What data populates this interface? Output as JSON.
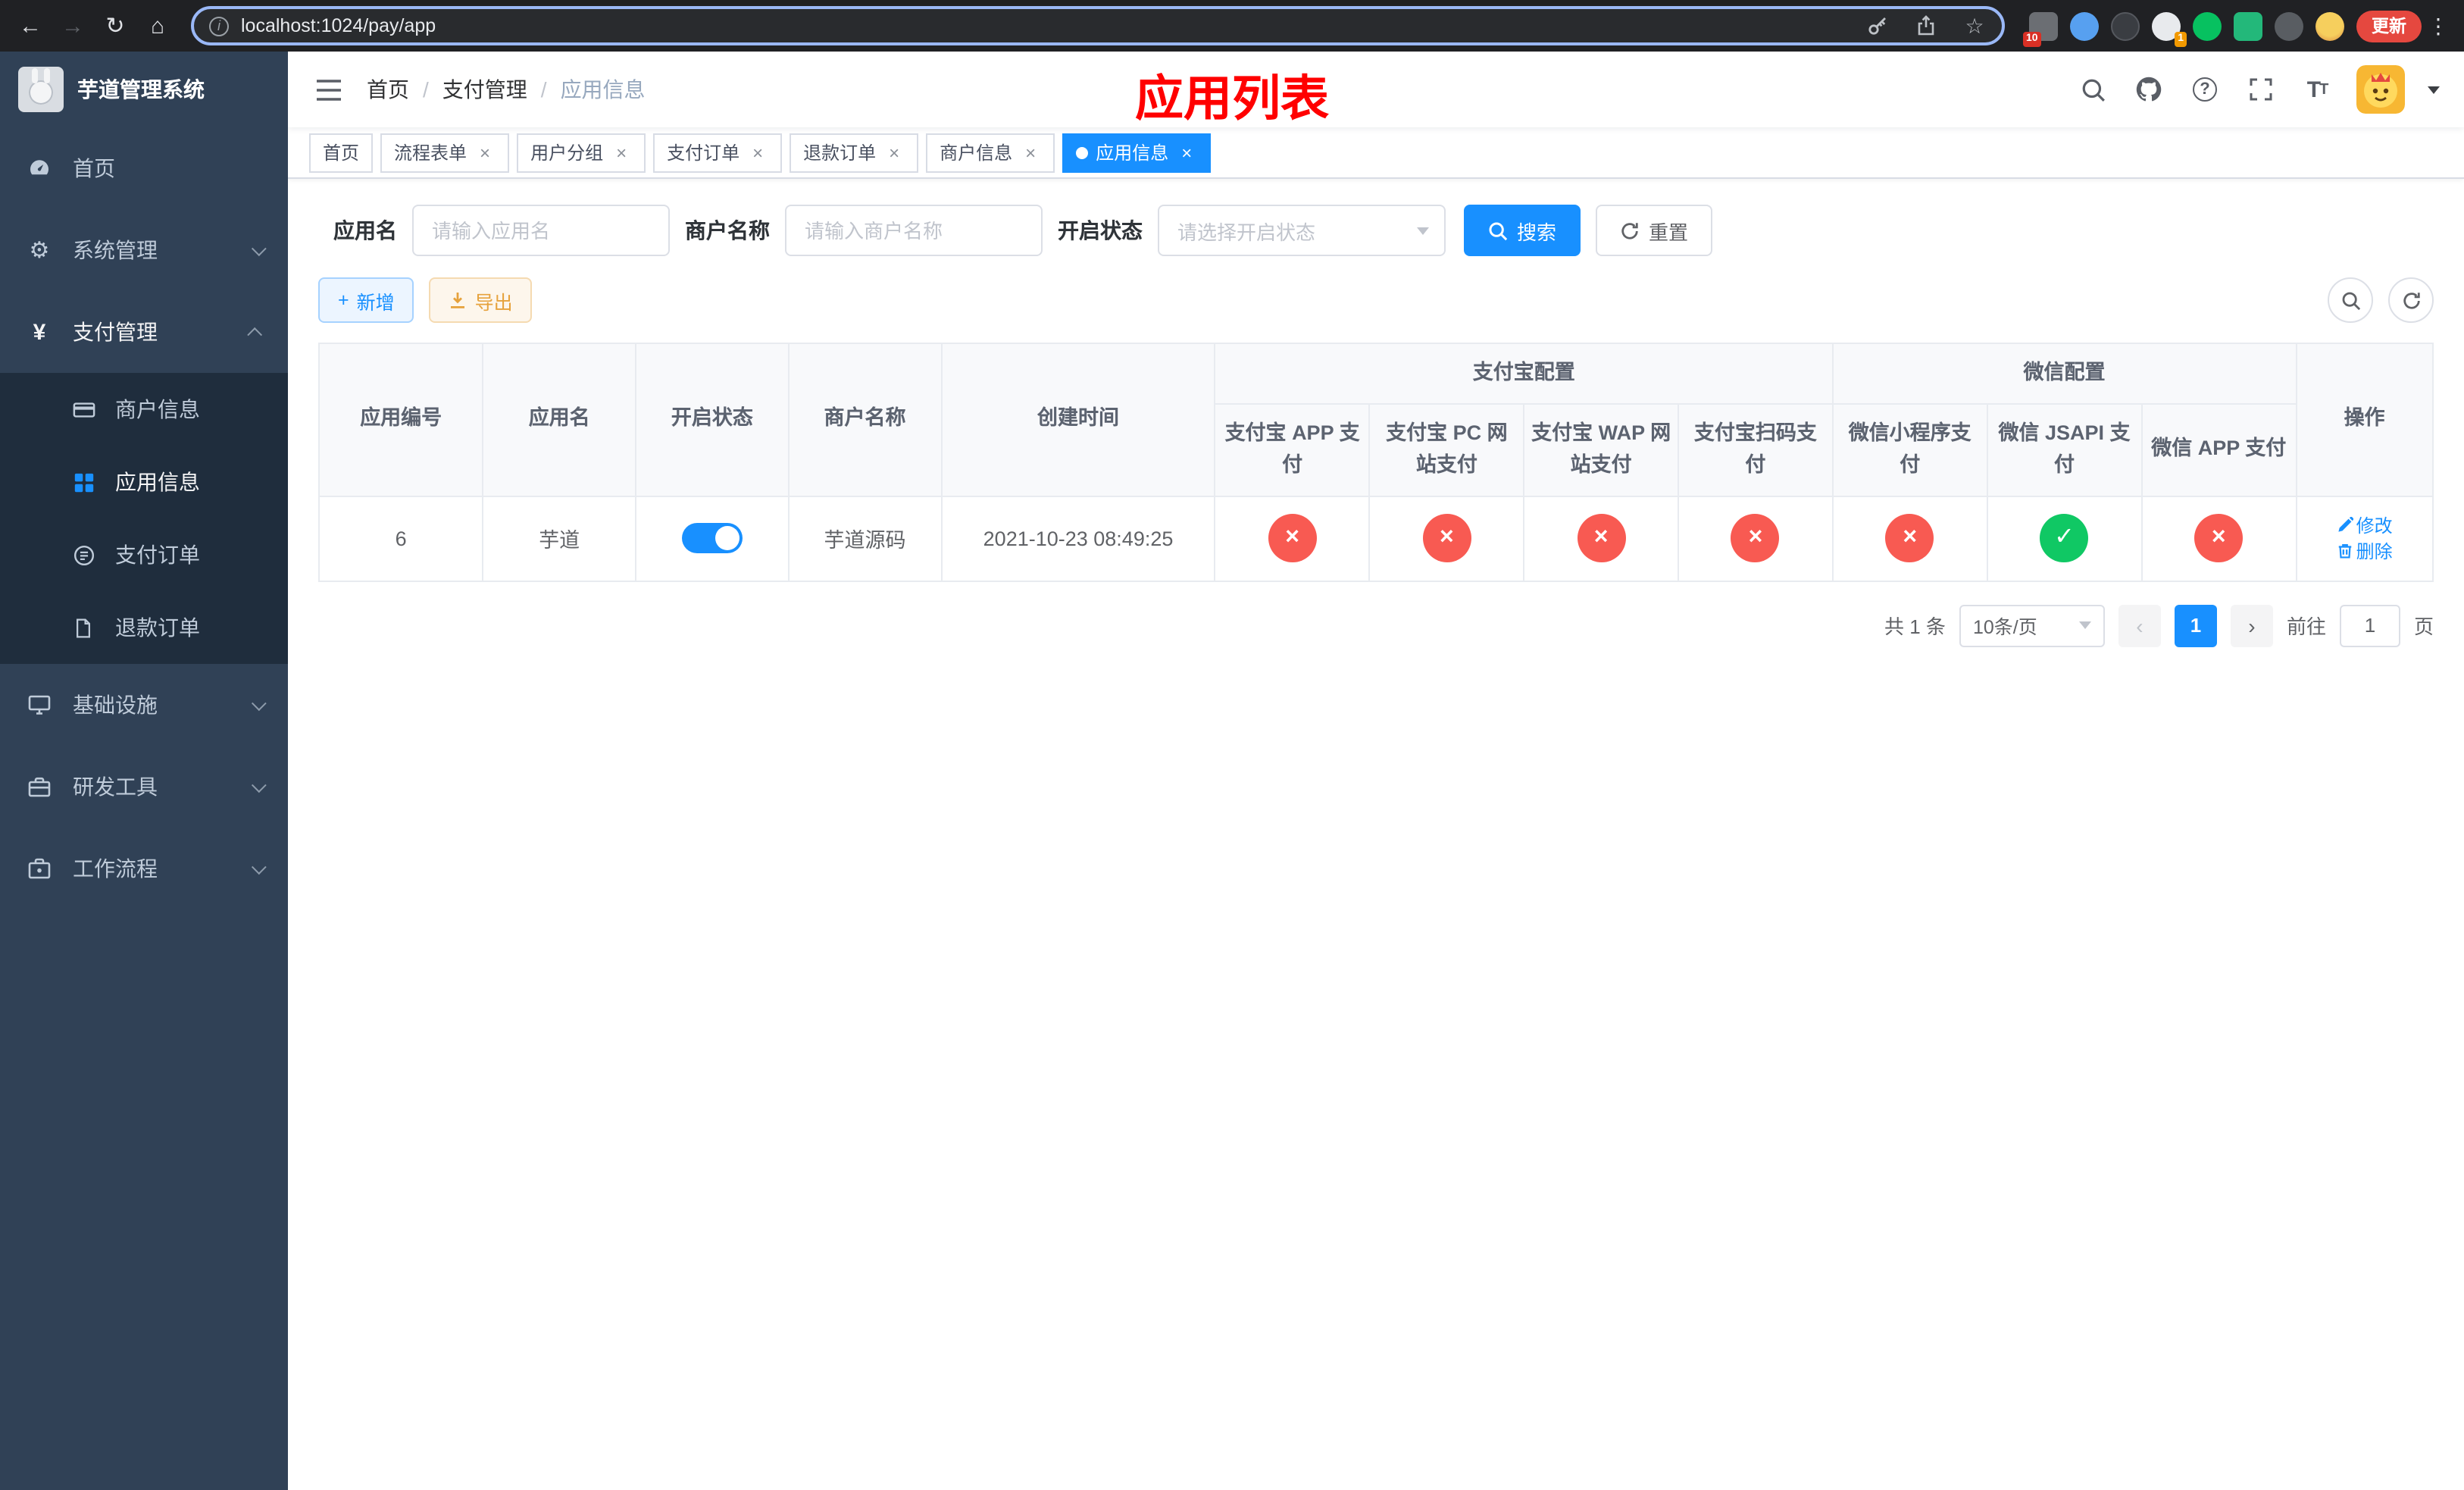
{
  "browser": {
    "url": "localhost:1024/pay/app",
    "update_button": "更新",
    "extension_badge_a": "10",
    "extension_badge_b": "1"
  },
  "icons": {
    "back": "←",
    "forward": "→",
    "reload": "↻",
    "home": "⌂",
    "info": "i",
    "star": "☆",
    "menu_dots": "⋮",
    "gear": "⚙",
    "yen": "¥",
    "plus": "+",
    "close": "×",
    "check": "✓",
    "cross": "×",
    "question": "?",
    "refresh": "↻"
  },
  "sidebar": {
    "app_title": "芋道管理系统",
    "items": {
      "home": "首页",
      "system": "系统管理",
      "payment": "支付管理",
      "merchant_info": "商户信息",
      "app_info": "应用信息",
      "pay_order": "支付订单",
      "refund_order": "退款订单",
      "infra": "基础设施",
      "dev_tools": "研发工具",
      "workflow": "工作流程"
    }
  },
  "header": {
    "breadcrumb": [
      "首页",
      "支付管理",
      "应用信息"
    ],
    "breadcrumb_sep": "/",
    "overlay_title": "应用列表",
    "font_icon_label": "T"
  },
  "tabs": [
    {
      "label": "首页"
    },
    {
      "label": "流程表单"
    },
    {
      "label": "用户分组"
    },
    {
      "label": "支付订单"
    },
    {
      "label": "退款订单"
    },
    {
      "label": "商户信息"
    },
    {
      "label": "应用信息"
    }
  ],
  "filters": {
    "app_name_label": "应用名",
    "app_name_placeholder": "请输入应用名",
    "merchant_name_label": "商户名称",
    "merchant_name_placeholder": "请输入商户名称",
    "status_label": "开启状态",
    "status_placeholder": "请选择开启状态",
    "search_button": "搜索",
    "reset_button": "重置"
  },
  "toolbar": {
    "add_button": "新增",
    "export_button": "导出"
  },
  "table": {
    "columns": {
      "app_id": "应用编号",
      "app_name": "应用名",
      "status": "开启状态",
      "merchant_name": "商户名称",
      "created_at": "创建时间",
      "alipay_group": "支付宝配置",
      "wechat_group": "微信配置",
      "alipay_app": "支付宝 APP 支付",
      "alipay_pc": "支付宝 PC 网站支付",
      "alipay_wap": "支付宝 WAP 网站支付",
      "alipay_qr": "支付宝扫码支付",
      "wechat_lite": "微信小程序支付",
      "wechat_jsapi": "微信 JSAPI 支付",
      "wechat_app": "微信 APP 支付",
      "actions": "操作"
    },
    "rows": [
      {
        "app_id": "6",
        "app_name": "芋道",
        "enabled": true,
        "merchant_name": "芋道源码",
        "created_at": "2021-10-23 08:49:25",
        "channels": {
          "alipay_app": false,
          "alipay_pc": false,
          "alipay_wap": false,
          "alipay_qr": false,
          "wechat_lite": false,
          "wechat_jsapi": true,
          "wechat_app": false
        },
        "edit_label": "修改",
        "delete_label": "删除"
      }
    ]
  },
  "pagination": {
    "total_text": "共 1 条",
    "page_size": "10条/页",
    "page": "1",
    "goto_prefix": "前往",
    "goto_value": "1",
    "goto_suffix": "页"
  }
}
